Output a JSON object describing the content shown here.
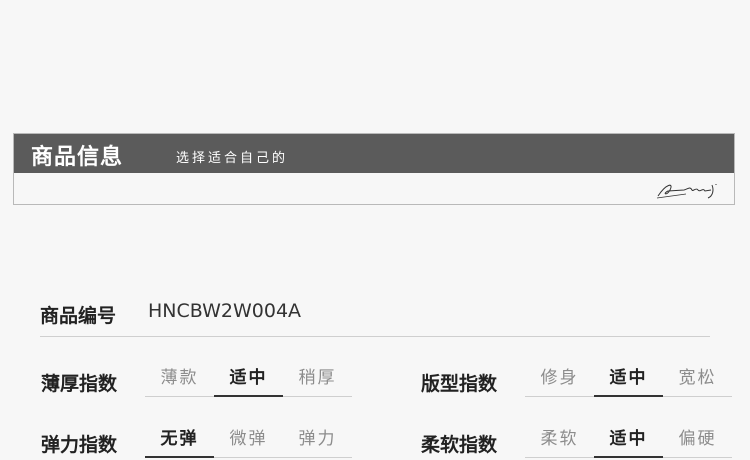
{
  "banner": {
    "title": "商品信息",
    "subtitle": "选择适合自己的"
  },
  "product": {
    "code_label": "商品编号",
    "code_value": "HNCBW2W004A"
  },
  "indices": {
    "thickness": {
      "label": "薄厚指数",
      "options": [
        "薄款",
        "适中",
        "稍厚"
      ],
      "selected": "适中"
    },
    "fit": {
      "label": "版型指数",
      "options": [
        "修身",
        "适中",
        "宽松"
      ],
      "selected": "适中"
    },
    "elasticity": {
      "label": "弹力指数",
      "options": [
        "无弹",
        "微弹",
        "弹力"
      ],
      "selected": "无弹"
    },
    "softness": {
      "label": "柔软指数",
      "options": [
        "柔软",
        "适中",
        "偏硬"
      ],
      "selected": "适中"
    }
  },
  "colors": {
    "banner_bar": "#5b5b5b",
    "divider": "#cfcfcf",
    "selected_underline": "#333333"
  }
}
